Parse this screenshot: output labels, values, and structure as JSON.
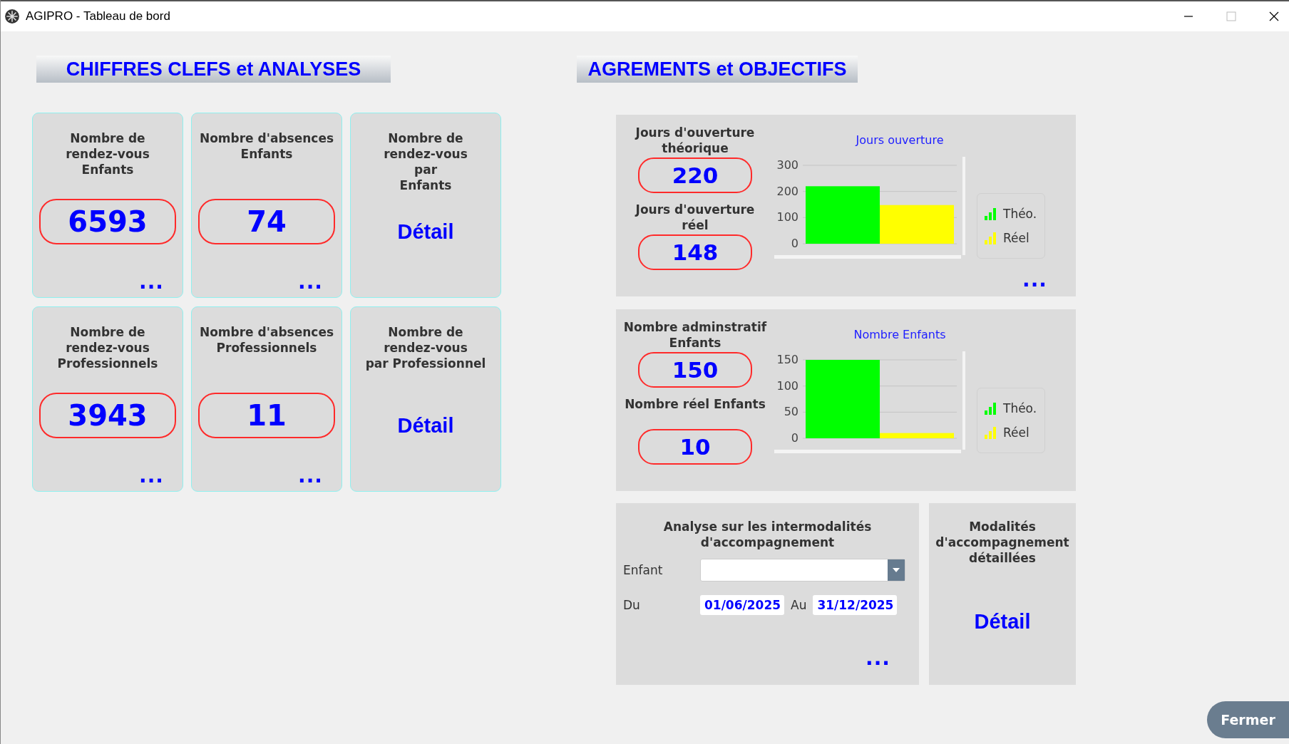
{
  "window": {
    "title": "AGIPRO - Tableau de bord"
  },
  "left_section": {
    "heading": "CHIFFRES CLEFS et ANALYSES",
    "cards": [
      {
        "kind": "value",
        "label": "Nombre de\nrendez-vous\nEnfants",
        "value": "6593",
        "more": "..."
      },
      {
        "kind": "value",
        "label": "Nombre d'absences\nEnfants",
        "value": "74",
        "more": "..."
      },
      {
        "kind": "detail",
        "label": "Nombre de\nrendez-vous\npar\nEnfants",
        "link": "Détail"
      },
      {
        "kind": "value",
        "label": "Nombre de\nrendez-vous\nProfessionnels",
        "value": "3943",
        "more": "..."
      },
      {
        "kind": "value",
        "label": "Nombre d'absences\nProfessionnels",
        "value": "11",
        "more": "..."
      },
      {
        "kind": "detail",
        "label": "Nombre de\nrendez-vous\npar Professionnel",
        "link": "Détail"
      }
    ]
  },
  "right_section": {
    "heading": "AGREMENTS et OBJECTIFS",
    "panels": [
      {
        "metrics": [
          {
            "label": "Jours d'ouverture\nthéorique",
            "value": "220"
          },
          {
            "label": "Jours d'ouverture\nréel",
            "value": "148"
          }
        ],
        "more": "...",
        "chart_data": {
          "type": "bar",
          "title": "Jours ouverture",
          "series": [
            {
              "name": "Théo.",
              "color": "#00ff00",
              "values": [
                220
              ]
            },
            {
              "name": "Réel",
              "color": "#ffff00",
              "values": [
                148
              ]
            }
          ],
          "ylim": [
            0,
            300
          ],
          "yticks": [
            0,
            100,
            200,
            300
          ]
        }
      },
      {
        "metrics": [
          {
            "label": "Nombre adminstratif\nEnfants",
            "value": "150"
          },
          {
            "label": "Nombre réel Enfants",
            "value": "10"
          }
        ],
        "chart_data": {
          "type": "bar",
          "title": "Nombre Enfants",
          "series": [
            {
              "name": "Théo.",
              "color": "#00ff00",
              "values": [
                150
              ]
            },
            {
              "name": "Réel",
              "color": "#ffff00",
              "values": [
                10
              ]
            }
          ],
          "ylim": [
            0,
            150
          ],
          "yticks": [
            0,
            50,
            100,
            150
          ]
        }
      }
    ],
    "analysis": {
      "title": "Analyse sur les intermodalités\nd'accompagnement",
      "child_label": "Enfant",
      "from_label": "Du",
      "from_date": "01/06/2025",
      "to_label": "Au",
      "to_date": "31/12/2025",
      "more": "..."
    },
    "detail_card": {
      "title": "Modalités\nd'accompagnement\ndétaillées",
      "link": "Détail"
    }
  },
  "close_button": "Fermer"
}
